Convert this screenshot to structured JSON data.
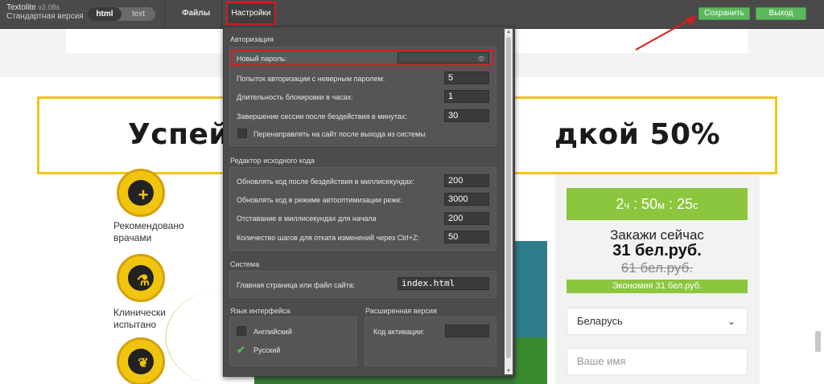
{
  "app": {
    "name": "Textolite",
    "version": "v2.08s",
    "edition": "Стандартная версия"
  },
  "toolbar": {
    "mode_html": "html",
    "mode_text": "text",
    "menu_files": "Файлы",
    "menu_settings": "Настройки",
    "save_label": "Сохранить",
    "exit_label": "Выход"
  },
  "colors": {
    "accent_green": "#5cb85c",
    "highlight_red": "#d61d1d",
    "timer_green": "#8cc63f",
    "promo_yellow": "#f0c419"
  },
  "settings": {
    "auth": {
      "title": "Авторизация",
      "new_password_label": "Новый пароль:",
      "new_password_value": "",
      "attempts_label": "Попыток авторизации с неверным паролем:",
      "attempts_value": "5",
      "lock_label": "Длительность блокировки в часах:",
      "lock_value": "1",
      "idle_label": "Завершение сессии после бездействия в минутах:",
      "idle_value": "30",
      "redirect_label": "Перенаправлять на сайт после выхода из системы",
      "redirect_checked": false
    },
    "editor": {
      "title": "Редактор исходного кода",
      "update_idle_label": "Обновлять код после бездействия в миллисекундах:",
      "update_idle_value": "200",
      "autoopt_label": "Обновлять код в режиме автооптимизации реже:",
      "autoopt_value": "3000",
      "delay_label": "Отставание в миллисекундах для начала",
      "delay_value": "200",
      "undo_label": "Количество шагов для отката изменений через Ctrl+Z:",
      "undo_value": "50"
    },
    "system": {
      "title": "Система",
      "home_label": "Главная страница или файл сайта:",
      "home_value": "index.html"
    },
    "language": {
      "title": "Язык интерфейса",
      "english": "Английский",
      "english_checked": false,
      "russian": "Русский",
      "russian_checked": true
    },
    "extended": {
      "title": "Расширенная версия",
      "activation_label": "Код активации:",
      "activation_value": ""
    }
  },
  "site": {
    "promo_left": "Успей",
    "promo_right": "дкой 50%",
    "badge1_line1": "Рекомендовано",
    "badge1_line2": "врачами",
    "badge2_line1": "Клинически",
    "badge2_line2": "испытано",
    "timer_h": "2",
    "timer_h_unit": "ч",
    "timer_m": "50",
    "timer_m_unit": "м",
    "timer_s": "25",
    "timer_s_unit": "с",
    "order_title": "Закажи сейчас",
    "price": "31 бел.руб.",
    "old_price": "61 бел.руб.",
    "savings": "Экономия 31 бел.руб.",
    "country": "Беларусь",
    "name_placeholder": "Ваше имя"
  }
}
